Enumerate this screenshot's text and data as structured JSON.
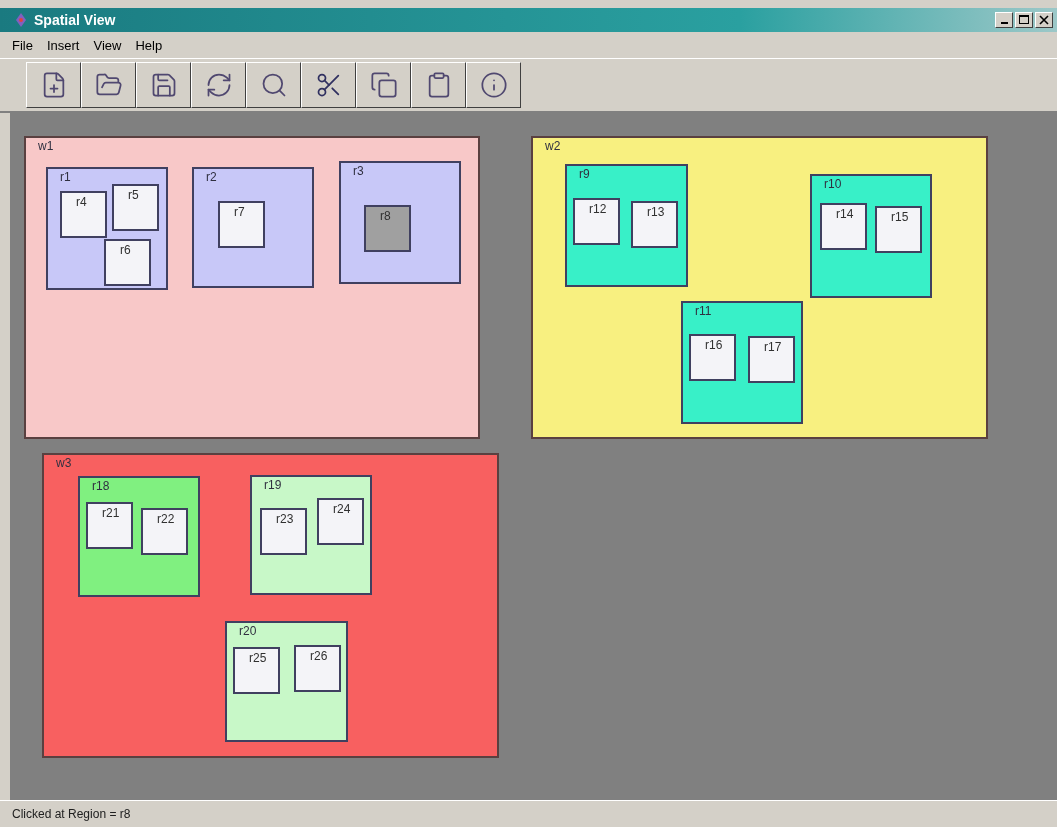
{
  "window": {
    "title": "Spatial View"
  },
  "menu": [
    "File",
    "Insert",
    "View",
    "Help"
  ],
  "windows": [
    {
      "label": "w1",
      "color": "#f8c8c8",
      "regions": [
        {
          "label": "r1",
          "color": "#c8c8f8",
          "children": [
            {
              "label": "r4",
              "selected": false
            },
            {
              "label": "r5",
              "selected": false
            },
            {
              "label": "r6",
              "selected": false
            }
          ]
        },
        {
          "label": "r2",
          "color": "#c8c8f8",
          "children": [
            {
              "label": "r7",
              "selected": false
            }
          ]
        },
        {
          "label": "r3",
          "color": "#c8c8f8",
          "children": [
            {
              "label": "r8",
              "selected": true
            }
          ]
        }
      ]
    },
    {
      "label": "w2",
      "color": "#f8f080",
      "regions": [
        {
          "label": "r9",
          "color": "#38f0c8",
          "children": [
            {
              "label": "r12",
              "selected": false
            },
            {
              "label": "r13",
              "selected": false
            }
          ]
        },
        {
          "label": "r10",
          "color": "#38f0c8",
          "children": [
            {
              "label": "r14",
              "selected": false
            },
            {
              "label": "r15",
              "selected": false
            }
          ]
        },
        {
          "label": "r11",
          "color": "#38f0c8",
          "children": [
            {
              "label": "r16",
              "selected": false
            },
            {
              "label": "r17",
              "selected": false
            }
          ]
        }
      ]
    },
    {
      "label": "w3",
      "color": "#f86060",
      "regions": [
        {
          "label": "r18",
          "color": "#80f080",
          "children": [
            {
              "label": "r21",
              "selected": false
            },
            {
              "label": "r22",
              "selected": false
            }
          ]
        },
        {
          "label": "r19",
          "color": "#c8f8c8",
          "children": [
            {
              "label": "r23",
              "selected": false
            },
            {
              "label": "r24",
              "selected": false
            }
          ]
        },
        {
          "label": "r20",
          "color": "#c8f8c8",
          "children": [
            {
              "label": "r25",
              "selected": false
            },
            {
              "label": "r26",
              "selected": false
            }
          ]
        }
      ]
    }
  ],
  "status_bar": "Clicked at Region = r8"
}
